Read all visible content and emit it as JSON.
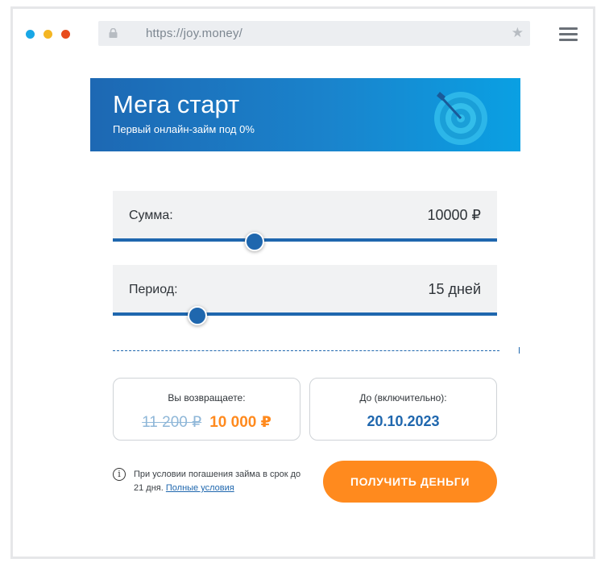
{
  "browser": {
    "url": "https://joy.money/",
    "window_dots": [
      "#19a7e6",
      "#f4b623",
      "#e84b1c"
    ],
    "icons": {
      "lock": "lock-icon",
      "bookmark": "star-icon",
      "menu": "hamburger-menu-icon"
    }
  },
  "banner": {
    "title": "Мега старт",
    "subtitle": "Первый онлайн-займ под 0%",
    "icon": "target-dart-icon",
    "gradient": [
      "#1d68b3",
      "#0aa0e3"
    ]
  },
  "amount_slider": {
    "label": "Сумма:",
    "value": "10000 ₽",
    "position_fraction": 0.37
  },
  "period_slider": {
    "label": "Период:",
    "value": "15 дней",
    "position_fraction": 0.22
  },
  "repay_card": {
    "label": "Вы возвращаете:",
    "old_amount": "11 200 ₽",
    "new_amount": "10 000 ₽"
  },
  "date_card": {
    "label": "До (включительно):",
    "date": "20.10.2023"
  },
  "info": {
    "icon": "info-icon",
    "text": "При условии погашения займа в срок до 21 дня.",
    "link": "Полные условия"
  },
  "cta": {
    "label": "ПОЛУЧИТЬ ДЕНЬГИ",
    "color": "#ff8a1e"
  },
  "colors": {
    "accent": "#1f67ae",
    "orange": "#ff8a1e"
  }
}
